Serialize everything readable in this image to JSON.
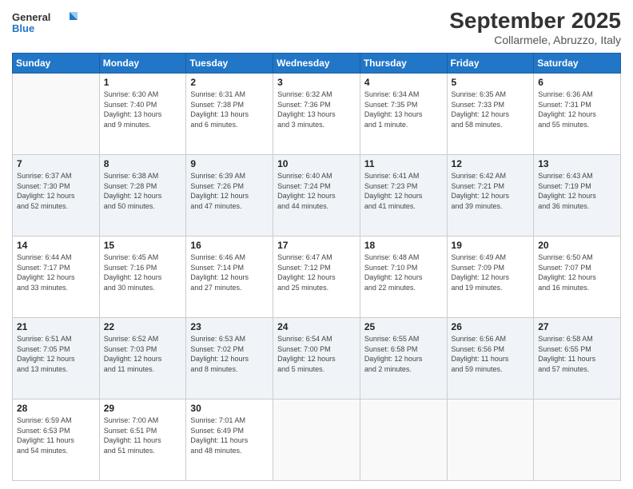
{
  "header": {
    "logo_line1": "General",
    "logo_line2": "Blue",
    "month_title": "September 2025",
    "location": "Collarmele, Abruzzo, Italy"
  },
  "weekdays": [
    "Sunday",
    "Monday",
    "Tuesday",
    "Wednesday",
    "Thursday",
    "Friday",
    "Saturday"
  ],
  "weeks": [
    [
      {
        "day": "",
        "info": ""
      },
      {
        "day": "1",
        "info": "Sunrise: 6:30 AM\nSunset: 7:40 PM\nDaylight: 13 hours\nand 9 minutes."
      },
      {
        "day": "2",
        "info": "Sunrise: 6:31 AM\nSunset: 7:38 PM\nDaylight: 13 hours\nand 6 minutes."
      },
      {
        "day": "3",
        "info": "Sunrise: 6:32 AM\nSunset: 7:36 PM\nDaylight: 13 hours\nand 3 minutes."
      },
      {
        "day": "4",
        "info": "Sunrise: 6:34 AM\nSunset: 7:35 PM\nDaylight: 13 hours\nand 1 minute."
      },
      {
        "day": "5",
        "info": "Sunrise: 6:35 AM\nSunset: 7:33 PM\nDaylight: 12 hours\nand 58 minutes."
      },
      {
        "day": "6",
        "info": "Sunrise: 6:36 AM\nSunset: 7:31 PM\nDaylight: 12 hours\nand 55 minutes."
      }
    ],
    [
      {
        "day": "7",
        "info": "Sunrise: 6:37 AM\nSunset: 7:30 PM\nDaylight: 12 hours\nand 52 minutes."
      },
      {
        "day": "8",
        "info": "Sunrise: 6:38 AM\nSunset: 7:28 PM\nDaylight: 12 hours\nand 50 minutes."
      },
      {
        "day": "9",
        "info": "Sunrise: 6:39 AM\nSunset: 7:26 PM\nDaylight: 12 hours\nand 47 minutes."
      },
      {
        "day": "10",
        "info": "Sunrise: 6:40 AM\nSunset: 7:24 PM\nDaylight: 12 hours\nand 44 minutes."
      },
      {
        "day": "11",
        "info": "Sunrise: 6:41 AM\nSunset: 7:23 PM\nDaylight: 12 hours\nand 41 minutes."
      },
      {
        "day": "12",
        "info": "Sunrise: 6:42 AM\nSunset: 7:21 PM\nDaylight: 12 hours\nand 39 minutes."
      },
      {
        "day": "13",
        "info": "Sunrise: 6:43 AM\nSunset: 7:19 PM\nDaylight: 12 hours\nand 36 minutes."
      }
    ],
    [
      {
        "day": "14",
        "info": "Sunrise: 6:44 AM\nSunset: 7:17 PM\nDaylight: 12 hours\nand 33 minutes."
      },
      {
        "day": "15",
        "info": "Sunrise: 6:45 AM\nSunset: 7:16 PM\nDaylight: 12 hours\nand 30 minutes."
      },
      {
        "day": "16",
        "info": "Sunrise: 6:46 AM\nSunset: 7:14 PM\nDaylight: 12 hours\nand 27 minutes."
      },
      {
        "day": "17",
        "info": "Sunrise: 6:47 AM\nSunset: 7:12 PM\nDaylight: 12 hours\nand 25 minutes."
      },
      {
        "day": "18",
        "info": "Sunrise: 6:48 AM\nSunset: 7:10 PM\nDaylight: 12 hours\nand 22 minutes."
      },
      {
        "day": "19",
        "info": "Sunrise: 6:49 AM\nSunset: 7:09 PM\nDaylight: 12 hours\nand 19 minutes."
      },
      {
        "day": "20",
        "info": "Sunrise: 6:50 AM\nSunset: 7:07 PM\nDaylight: 12 hours\nand 16 minutes."
      }
    ],
    [
      {
        "day": "21",
        "info": "Sunrise: 6:51 AM\nSunset: 7:05 PM\nDaylight: 12 hours\nand 13 minutes."
      },
      {
        "day": "22",
        "info": "Sunrise: 6:52 AM\nSunset: 7:03 PM\nDaylight: 12 hours\nand 11 minutes."
      },
      {
        "day": "23",
        "info": "Sunrise: 6:53 AM\nSunset: 7:02 PM\nDaylight: 12 hours\nand 8 minutes."
      },
      {
        "day": "24",
        "info": "Sunrise: 6:54 AM\nSunset: 7:00 PM\nDaylight: 12 hours\nand 5 minutes."
      },
      {
        "day": "25",
        "info": "Sunrise: 6:55 AM\nSunset: 6:58 PM\nDaylight: 12 hours\nand 2 minutes."
      },
      {
        "day": "26",
        "info": "Sunrise: 6:56 AM\nSunset: 6:56 PM\nDaylight: 11 hours\nand 59 minutes."
      },
      {
        "day": "27",
        "info": "Sunrise: 6:58 AM\nSunset: 6:55 PM\nDaylight: 11 hours\nand 57 minutes."
      }
    ],
    [
      {
        "day": "28",
        "info": "Sunrise: 6:59 AM\nSunset: 6:53 PM\nDaylight: 11 hours\nand 54 minutes."
      },
      {
        "day": "29",
        "info": "Sunrise: 7:00 AM\nSunset: 6:51 PM\nDaylight: 11 hours\nand 51 minutes."
      },
      {
        "day": "30",
        "info": "Sunrise: 7:01 AM\nSunset: 6:49 PM\nDaylight: 11 hours\nand 48 minutes."
      },
      {
        "day": "",
        "info": ""
      },
      {
        "day": "",
        "info": ""
      },
      {
        "day": "",
        "info": ""
      },
      {
        "day": "",
        "info": ""
      }
    ]
  ]
}
